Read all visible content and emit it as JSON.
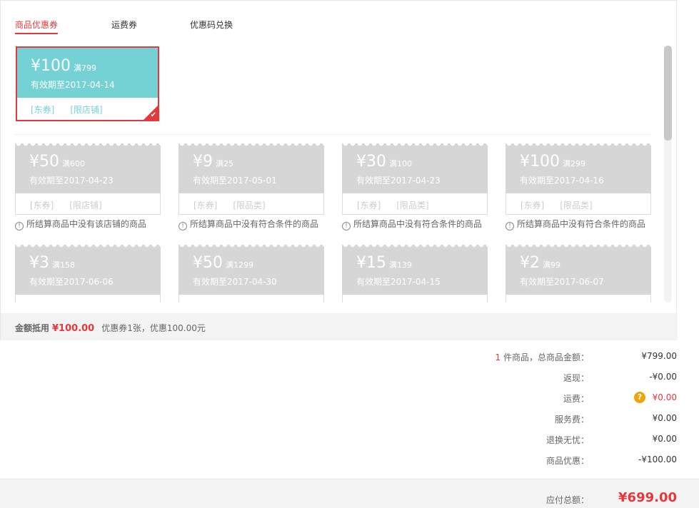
{
  "tabs": [
    "商品优惠券",
    "运费券",
    "优惠码兑换"
  ],
  "selected_coupon": {
    "amount": "¥100",
    "condition": "满799",
    "valid": "有效期至2017-04-14",
    "tags": [
      "[东券]",
      "[限店铺]"
    ]
  },
  "unavailable_coupons": [
    {
      "amount": "¥50",
      "condition": "满600",
      "valid": "有效期至2017-04-23",
      "tags": [
        "[东券]",
        "[限店铺]"
      ],
      "note": "所结算商品中没有该店铺的商品"
    },
    {
      "amount": "¥9",
      "condition": "满25",
      "valid": "有效期至2017-05-01",
      "tags": [
        "[东券]",
        "[限品类]"
      ],
      "note": "所结算商品中没有符合条件的商品"
    },
    {
      "amount": "¥30",
      "condition": "满100",
      "valid": "有效期至2017-04-23",
      "tags": [
        "[东券]",
        "[限品类]"
      ],
      "note": "所结算商品中没有符合条件的商品"
    },
    {
      "amount": "¥100",
      "condition": "满299",
      "valid": "有效期至2017-04-16",
      "tags": [
        "[东券]",
        "[限品类]"
      ],
      "note": "所结算商品中没有符合条件的商品"
    },
    {
      "amount": "¥3",
      "condition": "满158",
      "valid": "有效期至2017-06-06",
      "tags": [
        "",
        ""
      ],
      "note": ""
    },
    {
      "amount": "¥50",
      "condition": "满1299",
      "valid": "有效期至2017-04-30",
      "tags": [
        "",
        ""
      ],
      "note": ""
    },
    {
      "amount": "¥15",
      "condition": "满139",
      "valid": "有效期至2017-04-15",
      "tags": [
        "",
        ""
      ],
      "note": ""
    },
    {
      "amount": "¥2",
      "condition": "满99",
      "valid": "有效期至2017-06-07",
      "tags": [
        "",
        ""
      ],
      "note": ""
    }
  ],
  "summary": {
    "label": "金额抵用",
    "amount": "¥100.00",
    "desc": "优惠券1张，优惠100.00元"
  },
  "totals": {
    "count": "1",
    "count_suffix": " 件商品，总商品金额：",
    "goods_total": "¥799.00",
    "rows": [
      {
        "label": "返现：",
        "value": "-¥0.00"
      },
      {
        "label": "运费：",
        "value": "¥0.00"
      },
      {
        "label": "服务费：",
        "value": "¥0.00"
      },
      {
        "label": "退换无忧：",
        "value": "¥0.00"
      },
      {
        "label": "商品优惠：",
        "value": "-¥100.00"
      }
    ],
    "question_mark": "?",
    "payable_label": "应付总额：",
    "payable_value": "¥699.00"
  },
  "colors": {
    "accent": "#e4393c",
    "coupon_active": "#74d2d4",
    "coupon_disabled": "#d6d6d6",
    "badge": "#f0a30a"
  }
}
